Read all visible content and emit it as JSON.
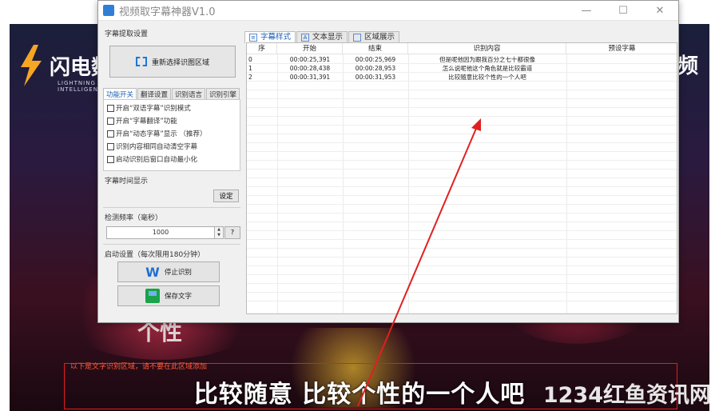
{
  "video": {
    "logo_text": "闪电数",
    "logo_sub": "LIGHTNING INTELLIGENT",
    "right_edge_text": "频",
    "background_text": "个性",
    "region_tip": "以下是文字识别区域，请不要在此区域添加",
    "subtitle": "比较随意 比较个性的一个人吧",
    "watermark": "1234红鱼资讯网"
  },
  "window": {
    "title": "视频取字幕神器V1.0",
    "controls": {
      "minimize": "—",
      "maximize": "☐",
      "close": "✕"
    }
  },
  "left": {
    "extract_group_label": "字幕提取设置",
    "select_region_button": "重新选择识图区域",
    "subtabs": [
      "功能开关",
      "翻译设置",
      "识别语言",
      "识别引擎"
    ],
    "options": [
      "开启“双语字幕”识别模式",
      "开启“字幕翻译”功能",
      "开启“动态字幕”显示  （推荐）",
      "识别内容相同自动清空字幕",
      "启动识别后窗口自动最小化"
    ],
    "time_label": "字幕时间显示",
    "set_button": "设定",
    "frequency_label": "检测频率（毫秒）",
    "frequency_value": "1000",
    "help_button": "?",
    "start_label": "启动设置（每次限用180分钟）",
    "stop_button": "停止识别",
    "save_button": "保存文字"
  },
  "tabs": [
    "字幕样式",
    "文本显示",
    "区域展示"
  ],
  "table": {
    "headers": [
      "序",
      "开始",
      "结束",
      "识别内容",
      "预设字幕"
    ],
    "rows": [
      [
        "0",
        "00:00:25,391",
        "00:00:25,969",
        "但是呢他因为跟我百分之七十都很像",
        ""
      ],
      [
        "1",
        "00:00:28,438",
        "00:00:28,953",
        "怎么说呢他这个角色就是比较霸道",
        ""
      ],
      [
        "2",
        "00:00:31,391",
        "00:00:31,953",
        "比较随意比较个性的一个人吧",
        ""
      ]
    ]
  },
  "colors": {
    "accent": "#1a5fb4",
    "arrow": "#e02020",
    "region_border": "#e02020"
  }
}
